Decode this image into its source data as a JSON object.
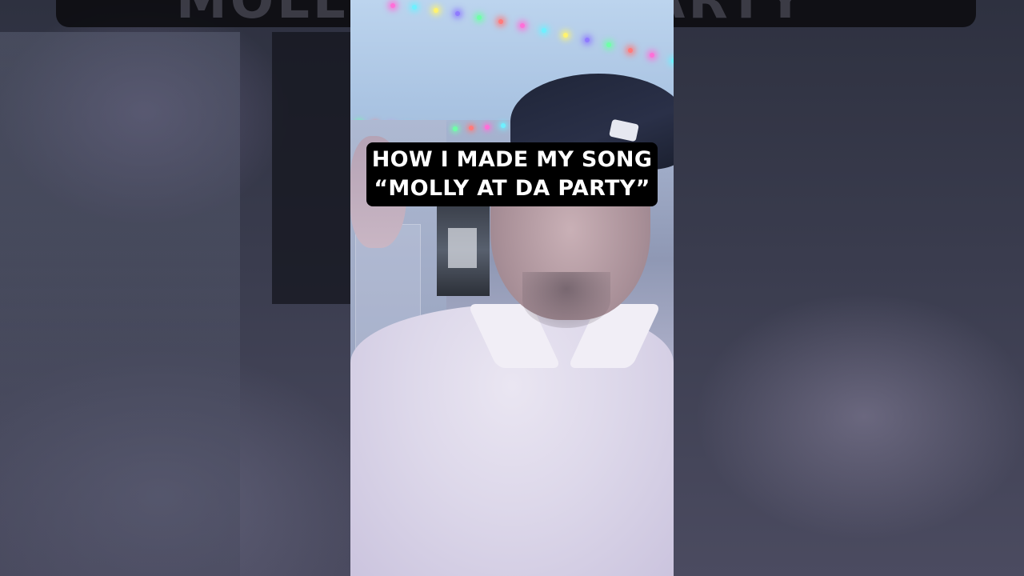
{
  "caption": {
    "line1": "HOW I MADE MY SONG",
    "line2": "“MOLLY AT DA PARTY”"
  },
  "background_banner_text": "MOLLY AT DA PARTY",
  "colors": {
    "caption_bg": "#000000",
    "caption_text": "#ffffff"
  },
  "lights": [
    "#ff6fd8",
    "#6ff0ff",
    "#fff36f",
    "#8f7bff",
    "#6fffa8",
    "#ff7b7b"
  ]
}
